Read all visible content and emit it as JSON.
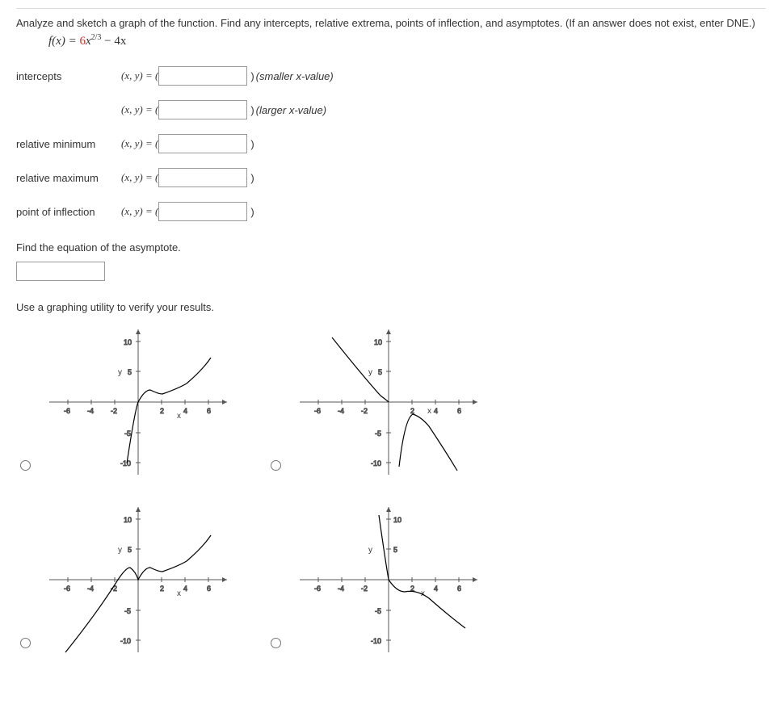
{
  "problem": {
    "instructions": "Analyze and sketch a graph of the function. Find any intercepts, relative extrema, points of inflection, and asymptotes. (If an answer does not exist, enter DNE.)",
    "func_lhs": "f(x) = ",
    "func_coef": "6",
    "func_mid": "x",
    "func_exp": "2/3",
    "func_tail": " − 4x"
  },
  "rows": {
    "intercepts_label": "intercepts",
    "rel_min_label": "relative minimum",
    "rel_max_label": "relative maximum",
    "poi_label": "point of inflection",
    "xy_eq": "(x, y) = (",
    "close_paren": ")",
    "smaller_x": "(smaller x-value)",
    "larger_x": "(larger x-value)"
  },
  "asymptote": {
    "prompt": "Find the equation of the asymptote."
  },
  "verify_prompt": "Use a graphing utility to verify your results.",
  "axes": {
    "y_label": "y",
    "x_label": "x",
    "ticks_x": [
      "-6",
      "-4",
      "-2",
      "2",
      "4",
      "6"
    ],
    "ticks_y": [
      "-10",
      "-5",
      "5",
      "10"
    ]
  },
  "chart_data": [
    {
      "type": "line",
      "title": "",
      "xlim": [
        -7,
        7
      ],
      "ylim": [
        -12,
        12
      ],
      "xticks": [
        -6,
        -4,
        -2,
        2,
        4,
        6
      ],
      "yticks": [
        -10,
        -5,
        5,
        10
      ],
      "xlabel": "x",
      "ylabel": "y",
      "series": [
        {
          "name": "curve",
          "points": [
            [
              -1,
              -10
            ],
            [
              0,
              0
            ],
            [
              1,
              2
            ],
            [
              2,
              1.5
            ],
            [
              4,
              3.2
            ],
            [
              6,
              7.5
            ]
          ]
        }
      ]
    },
    {
      "type": "line",
      "title": "",
      "xlim": [
        -7,
        7
      ],
      "ylim": [
        -12,
        12
      ],
      "xticks": [
        -6,
        -4,
        -2,
        2,
        4,
        6
      ],
      "yticks": [
        -10,
        -5,
        5,
        10
      ],
      "xlabel": "x",
      "ylabel": "y",
      "series": [
        {
          "name": "left",
          "points": [
            [
              -5,
              11
            ],
            [
              -1,
              1
            ],
            [
              0,
              0
            ]
          ]
        },
        {
          "name": "right",
          "points": [
            [
              1,
              -10.5
            ],
            [
              2,
              -2
            ],
            [
              3,
              -4
            ],
            [
              6,
              -11
            ]
          ]
        }
      ]
    },
    {
      "type": "line",
      "title": "",
      "xlim": [
        -7,
        7
      ],
      "ylim": [
        -12,
        12
      ],
      "xticks": [
        -6,
        -4,
        -2,
        2,
        4,
        6
      ],
      "yticks": [
        -10,
        -5,
        5,
        10
      ],
      "xlabel": "x",
      "ylabel": "y",
      "series": [
        {
          "name": "curve",
          "points": [
            [
              -6,
              -11
            ],
            [
              -4,
              -5
            ],
            [
              -1,
              2
            ],
            [
              0,
              0
            ],
            [
              1,
              2
            ],
            [
              2,
              1.5
            ],
            [
              4,
              3.2
            ],
            [
              6,
              7.5
            ]
          ]
        }
      ]
    },
    {
      "type": "line",
      "title": "",
      "xlim": [
        -7,
        7
      ],
      "ylim": [
        -12,
        12
      ],
      "xticks": [
        -6,
        -4,
        -2,
        2,
        4,
        6
      ],
      "yticks": [
        -10,
        -5,
        5,
        10
      ],
      "xlabel": "x",
      "ylabel": "y",
      "series": [
        {
          "name": "left",
          "points": [
            [
              -1,
              10.5
            ],
            [
              0,
              0
            ]
          ]
        },
        {
          "name": "right",
          "points": [
            [
              0,
              0
            ],
            [
              1,
              -2
            ],
            [
              3,
              -3
            ],
            [
              6,
              -7.5
            ]
          ]
        }
      ]
    }
  ]
}
